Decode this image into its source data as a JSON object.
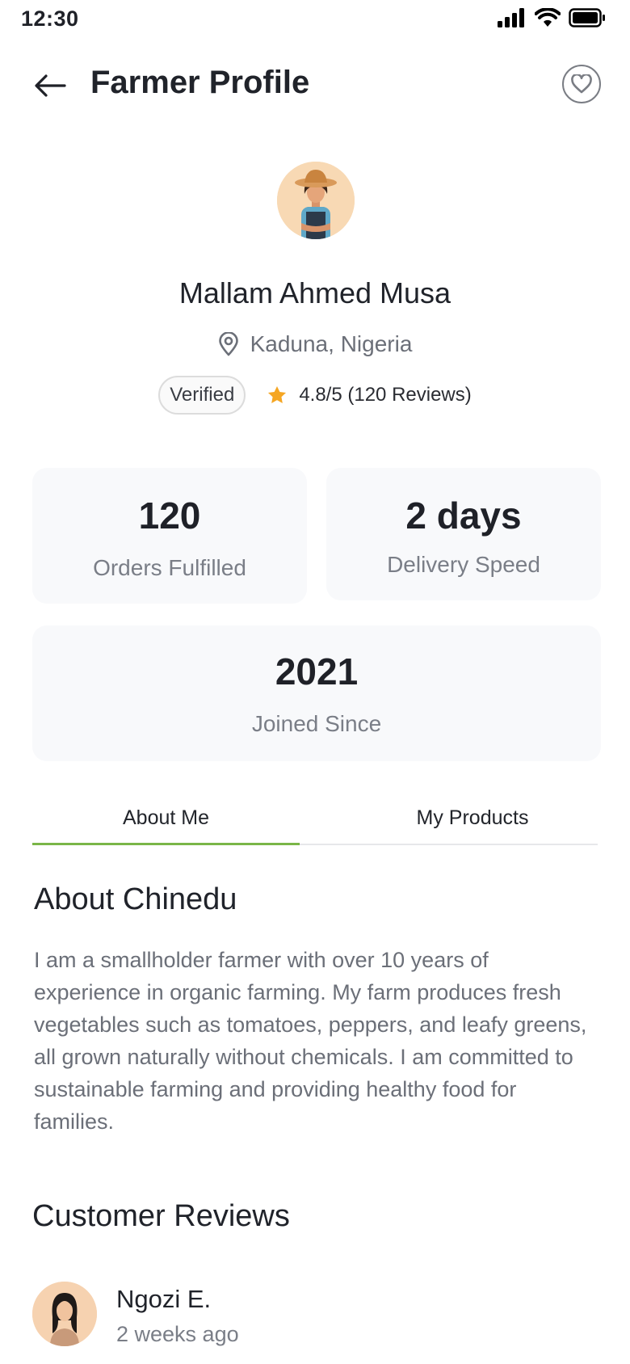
{
  "status": {
    "time": "12:30"
  },
  "header": {
    "title": "Farmer Profile"
  },
  "profile": {
    "name": "Mallam Ahmed Musa",
    "location": "Kaduna, Nigeria",
    "badge": "Verified",
    "rating": "4.8/5 (120 Reviews)"
  },
  "stats": {
    "orders": {
      "value": "120",
      "label": "Orders Fulfilled"
    },
    "delivery": {
      "value": "2 days",
      "label": "Delivery Speed"
    },
    "joined": {
      "value": "2021",
      "label": "Joined Since"
    }
  },
  "tabs": [
    {
      "label": "About Me",
      "active": true
    },
    {
      "label": "My Products",
      "active": false
    }
  ],
  "about": {
    "title": "About Chinedu",
    "text": "I am a smallholder farmer with over 10 years of experience in organic farming. My farm produces fresh vegetables such as tomatoes, peppers, and leafy greens, all grown naturally without chemicals. I am committed to sustainable farming and providing healthy food for families."
  },
  "reviews": {
    "title": "Customer Reviews",
    "items": [
      {
        "name": "Ngozi E.",
        "time": "2 weeks ago"
      }
    ]
  },
  "colors": {
    "accent": "#7ab648",
    "star": "#f5a623",
    "card_bg": "#f8f9fb"
  }
}
